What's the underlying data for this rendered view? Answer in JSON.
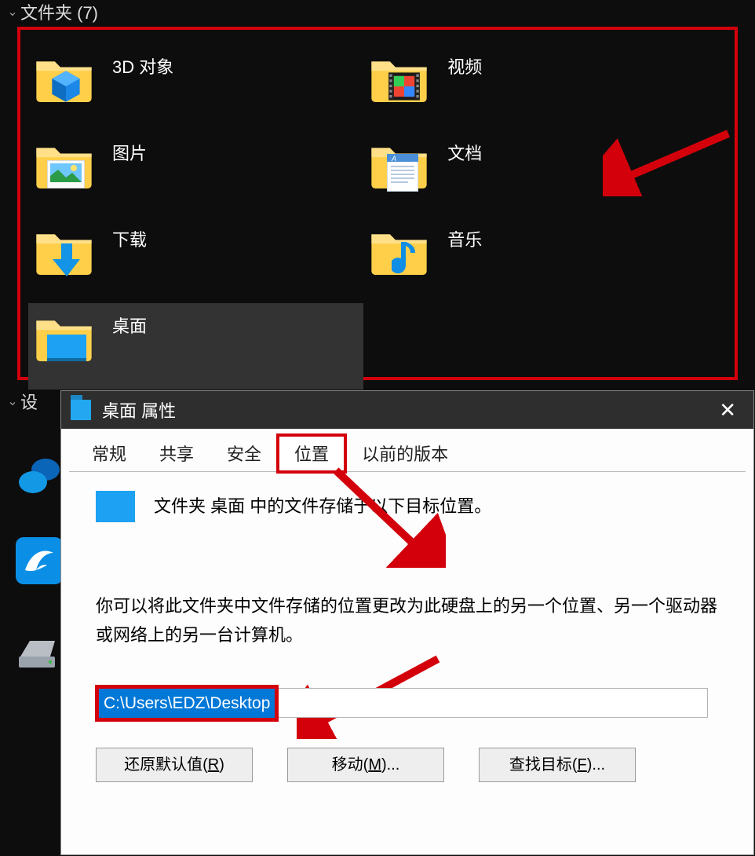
{
  "explorer": {
    "section_header": "文件夹 (7)",
    "folders": [
      {
        "label": "3D 对象"
      },
      {
        "label": "视频"
      },
      {
        "label": "图片"
      },
      {
        "label": "文档"
      },
      {
        "label": "下载"
      },
      {
        "label": "音乐"
      },
      {
        "label": "桌面"
      }
    ],
    "devices_header": "设"
  },
  "dialog": {
    "title": "桌面 属性",
    "tabs": {
      "general": "常规",
      "share": "共享",
      "security": "安全",
      "location": "位置",
      "previous": "以前的版本"
    },
    "description1": "文件夹 桌面 中的文件存储于以下目标位置。",
    "description2": "你可以将此文件夹中文件存储的位置更改为此硬盘上的另一个位置、另一个驱动器或网络上的另一台计算机。",
    "path_value": "C:\\Users\\EDZ\\Desktop",
    "buttons": {
      "restore_prefix": "还原默认值(",
      "restore_key": "R",
      "restore_suffix": ")",
      "move_prefix": "移动(",
      "move_key": "M",
      "move_suffix": ")...",
      "find_prefix": "查找目标(",
      "find_key": "F",
      "find_suffix": ")..."
    }
  },
  "annotation_color": "#d3000b"
}
